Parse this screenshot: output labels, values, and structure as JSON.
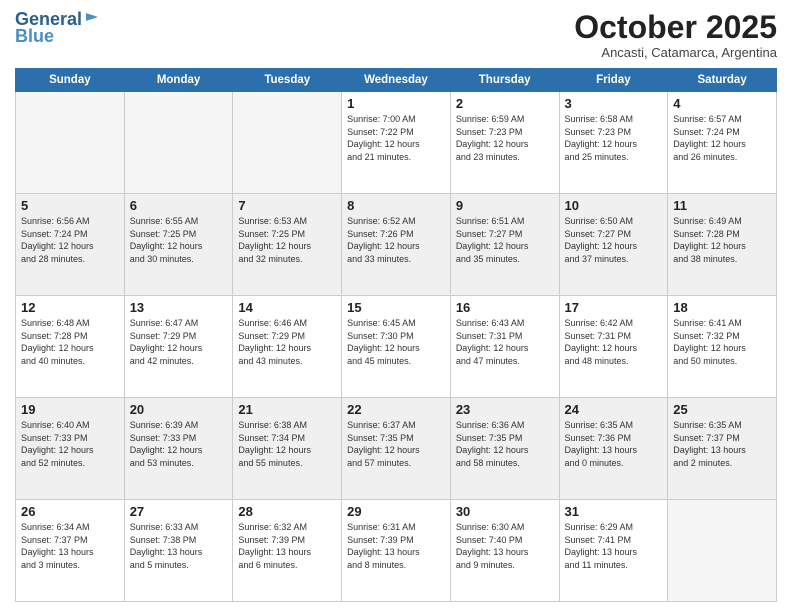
{
  "header": {
    "logo_general": "General",
    "logo_blue": "Blue",
    "month_title": "October 2025",
    "subtitle": "Ancasti, Catamarca, Argentina"
  },
  "weekdays": [
    "Sunday",
    "Monday",
    "Tuesday",
    "Wednesday",
    "Thursday",
    "Friday",
    "Saturday"
  ],
  "weeks": [
    [
      {
        "day": "",
        "info": ""
      },
      {
        "day": "",
        "info": ""
      },
      {
        "day": "",
        "info": ""
      },
      {
        "day": "1",
        "info": "Sunrise: 7:00 AM\nSunset: 7:22 PM\nDaylight: 12 hours\nand 21 minutes."
      },
      {
        "day": "2",
        "info": "Sunrise: 6:59 AM\nSunset: 7:23 PM\nDaylight: 12 hours\nand 23 minutes."
      },
      {
        "day": "3",
        "info": "Sunrise: 6:58 AM\nSunset: 7:23 PM\nDaylight: 12 hours\nand 25 minutes."
      },
      {
        "day": "4",
        "info": "Sunrise: 6:57 AM\nSunset: 7:24 PM\nDaylight: 12 hours\nand 26 minutes."
      }
    ],
    [
      {
        "day": "5",
        "info": "Sunrise: 6:56 AM\nSunset: 7:24 PM\nDaylight: 12 hours\nand 28 minutes."
      },
      {
        "day": "6",
        "info": "Sunrise: 6:55 AM\nSunset: 7:25 PM\nDaylight: 12 hours\nand 30 minutes."
      },
      {
        "day": "7",
        "info": "Sunrise: 6:53 AM\nSunset: 7:25 PM\nDaylight: 12 hours\nand 32 minutes."
      },
      {
        "day": "8",
        "info": "Sunrise: 6:52 AM\nSunset: 7:26 PM\nDaylight: 12 hours\nand 33 minutes."
      },
      {
        "day": "9",
        "info": "Sunrise: 6:51 AM\nSunset: 7:27 PM\nDaylight: 12 hours\nand 35 minutes."
      },
      {
        "day": "10",
        "info": "Sunrise: 6:50 AM\nSunset: 7:27 PM\nDaylight: 12 hours\nand 37 minutes."
      },
      {
        "day": "11",
        "info": "Sunrise: 6:49 AM\nSunset: 7:28 PM\nDaylight: 12 hours\nand 38 minutes."
      }
    ],
    [
      {
        "day": "12",
        "info": "Sunrise: 6:48 AM\nSunset: 7:28 PM\nDaylight: 12 hours\nand 40 minutes."
      },
      {
        "day": "13",
        "info": "Sunrise: 6:47 AM\nSunset: 7:29 PM\nDaylight: 12 hours\nand 42 minutes."
      },
      {
        "day": "14",
        "info": "Sunrise: 6:46 AM\nSunset: 7:29 PM\nDaylight: 12 hours\nand 43 minutes."
      },
      {
        "day": "15",
        "info": "Sunrise: 6:45 AM\nSunset: 7:30 PM\nDaylight: 12 hours\nand 45 minutes."
      },
      {
        "day": "16",
        "info": "Sunrise: 6:43 AM\nSunset: 7:31 PM\nDaylight: 12 hours\nand 47 minutes."
      },
      {
        "day": "17",
        "info": "Sunrise: 6:42 AM\nSunset: 7:31 PM\nDaylight: 12 hours\nand 48 minutes."
      },
      {
        "day": "18",
        "info": "Sunrise: 6:41 AM\nSunset: 7:32 PM\nDaylight: 12 hours\nand 50 minutes."
      }
    ],
    [
      {
        "day": "19",
        "info": "Sunrise: 6:40 AM\nSunset: 7:33 PM\nDaylight: 12 hours\nand 52 minutes."
      },
      {
        "day": "20",
        "info": "Sunrise: 6:39 AM\nSunset: 7:33 PM\nDaylight: 12 hours\nand 53 minutes."
      },
      {
        "day": "21",
        "info": "Sunrise: 6:38 AM\nSunset: 7:34 PM\nDaylight: 12 hours\nand 55 minutes."
      },
      {
        "day": "22",
        "info": "Sunrise: 6:37 AM\nSunset: 7:35 PM\nDaylight: 12 hours\nand 57 minutes."
      },
      {
        "day": "23",
        "info": "Sunrise: 6:36 AM\nSunset: 7:35 PM\nDaylight: 12 hours\nand 58 minutes."
      },
      {
        "day": "24",
        "info": "Sunrise: 6:35 AM\nSunset: 7:36 PM\nDaylight: 13 hours\nand 0 minutes."
      },
      {
        "day": "25",
        "info": "Sunrise: 6:35 AM\nSunset: 7:37 PM\nDaylight: 13 hours\nand 2 minutes."
      }
    ],
    [
      {
        "day": "26",
        "info": "Sunrise: 6:34 AM\nSunset: 7:37 PM\nDaylight: 13 hours\nand 3 minutes."
      },
      {
        "day": "27",
        "info": "Sunrise: 6:33 AM\nSunset: 7:38 PM\nDaylight: 13 hours\nand 5 minutes."
      },
      {
        "day": "28",
        "info": "Sunrise: 6:32 AM\nSunset: 7:39 PM\nDaylight: 13 hours\nand 6 minutes."
      },
      {
        "day": "29",
        "info": "Sunrise: 6:31 AM\nSunset: 7:39 PM\nDaylight: 13 hours\nand 8 minutes."
      },
      {
        "day": "30",
        "info": "Sunrise: 6:30 AM\nSunset: 7:40 PM\nDaylight: 13 hours\nand 9 minutes."
      },
      {
        "day": "31",
        "info": "Sunrise: 6:29 AM\nSunset: 7:41 PM\nDaylight: 13 hours\nand 11 minutes."
      },
      {
        "day": "",
        "info": ""
      }
    ]
  ]
}
